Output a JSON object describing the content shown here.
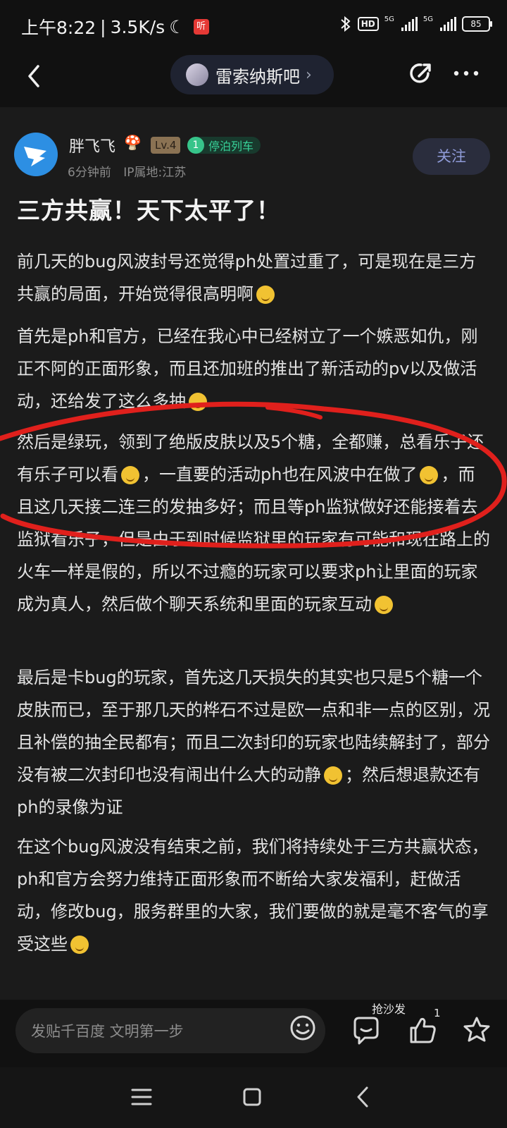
{
  "status_bar": {
    "time": "上午8:22",
    "speed": "3.5K/s",
    "notify_badge": "听",
    "hd_badge": "HD",
    "net1": "5G",
    "net2": "5G",
    "battery": "85"
  },
  "nav": {
    "forum_name": "雷索纳斯吧"
  },
  "post": {
    "author_name": "胖飞飞",
    "level": "Lv.4",
    "title_badge_num": "1",
    "title_badge": "停泊列车",
    "time_ago": "6分钟前",
    "ip": "IP属地:江苏",
    "follow_label": "关注",
    "title": "三方共赢！天下太平了！",
    "p1": "前几天的bug风波封号还觉得ph处置过重了，可是现在是三方共赢的局面，开始觉得很高明啊",
    "p2": "首先是ph和官方，已经在我心中已经树立了一个嫉恶如仇，刚正不阿的正面形象，而且还加班的推出了新活动的pv以及做活动，还给发了这么多抽",
    "p3a": "然后是绿玩，领到了绝版皮肤以及5个糖，全都赚，总看乐子还有乐子可以看",
    "p3b": "，一直要的活动ph也在风波中在做了",
    "p3c": "，而且这几天接二连三的发抽多好；而且等ph监狱做好还能接着去监狱看乐子，但是由于到时候监狱里的玩家有可能和现在路上的火车一样是假的，所以不过瘾的玩家可以要求ph让里面的玩家成为真人，然后做个聊天系统和里面的玩家互动",
    "p4a": "最后是卡bug的玩家，首先这几天损失的其实也只是5个糖一个皮肤而已，至于那几天的桦石不过是欧一点和非一点的区别，况且补偿的抽全民都有；而且二次封印的玩家也陆续解封了，部分没有被二次封印也没有闹出什么大的动静",
    "p4b": "；然后想退款还有ph的录像为证",
    "p5": "在这个bug风波没有结束之前，我们将持续处于三方共赢状态，ph和官方会努力维持正面形象而不断给大家发福利，赶做活动，修改bug，服务群里的大家，我们要做的就是毫不客气的享受这些"
  },
  "actions": {
    "comment_placeholder": "发贴千百度 文明第一步",
    "sofa_label": "抢沙发",
    "like_count": "1"
  },
  "colors": {
    "background": "#111111",
    "post_bg": "#1b1b1b",
    "accent_follow": "#8f9bd8",
    "badge_green": "#38d39a",
    "annotation_red": "#e0201c"
  }
}
